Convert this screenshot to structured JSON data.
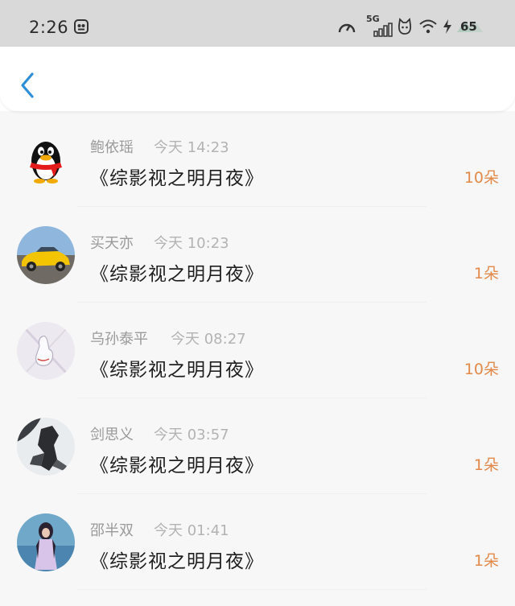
{
  "status_bar": {
    "time": "2:26",
    "network": "5G",
    "battery": "65"
  },
  "colors": {
    "accent": "#2f8ed8",
    "flower_count": "#e38a4b",
    "status_bar_bg": "#d9d9d9"
  },
  "list": {
    "items": [
      {
        "name": "鲍依瑶",
        "time": "今天 14:23",
        "title": "《综影视之明月夜》",
        "count": "10朵",
        "avatar_icon": "qq-penguin-avatar"
      },
      {
        "name": "买天亦",
        "time": "今天 10:23",
        "title": "《综影视之明月夜》",
        "count": "1朵",
        "avatar_icon": "yellow-car-avatar"
      },
      {
        "name": "乌孙泰平",
        "time": "今天 08:27",
        "title": "《综影视之明月夜》",
        "count": "10朵",
        "avatar_icon": "hand-sketch-avatar"
      },
      {
        "name": "剑思义",
        "time": "今天 03:57",
        "title": "《综影视之明月夜》",
        "count": "1朵",
        "avatar_icon": "dancer-avatar"
      },
      {
        "name": "邵半双",
        "time": "今天 01:41",
        "title": "《综影视之明月夜》",
        "count": "1朵",
        "avatar_icon": "girl-photo-avatar"
      }
    ]
  }
}
